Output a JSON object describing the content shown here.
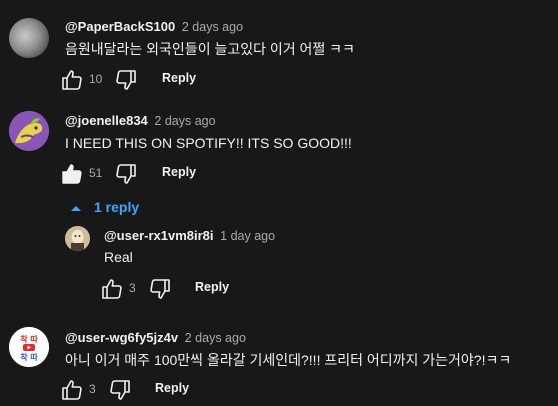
{
  "comments": [
    {
      "author": "@PaperBackS100",
      "time": "2 days ago",
      "text": "음원내달라는 외국인들이 늘고있다 이거 어쩔 ㅋㅋ",
      "likes": "10",
      "reply_label": "Reply"
    },
    {
      "author": "@joenelle834",
      "time": "2 days ago",
      "text": "I NEED THIS ON SPOTIFY!! ITS SO GOOD!!!",
      "likes": "51",
      "reply_label": "Reply",
      "replies_toggle": "1 reply",
      "replies": [
        {
          "author": "@user-rx1vm8ir8i",
          "time": "1 day ago",
          "text": "Real",
          "likes": "3",
          "reply_label": "Reply"
        }
      ]
    },
    {
      "author": "@user-wg6fy5jz4v",
      "time": "2 days ago",
      "text": "아니 이거 매주 100만씩 올라갈 기세인데?!!! 프리터 어디까지 가는거야?!ㅋㅋ",
      "likes": "3",
      "reply_label": "Reply"
    }
  ],
  "avatar4_text": [
    "착 따",
    "착 따"
  ],
  "colors": {
    "background": "#181818",
    "link": "#3ea6ff",
    "muted": "#aaaaaa"
  }
}
